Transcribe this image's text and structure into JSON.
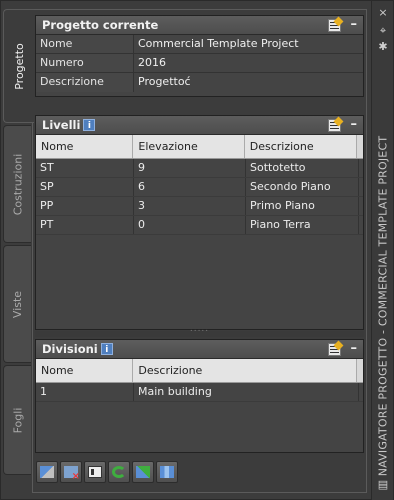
{
  "left_tabs": [
    {
      "label": "Progetto",
      "active": true
    },
    {
      "label": "Costruzioni",
      "active": false
    },
    {
      "label": "Viste",
      "active": false
    },
    {
      "label": "Fogli",
      "active": false
    }
  ],
  "palette_title": "NAVIGATORE PROGETTO - COMMERCIAL TEMPLATE PROJECT",
  "project": {
    "title": "Progetto corrente",
    "rows": [
      {
        "key": "Nome",
        "value": "Commercial Template Project"
      },
      {
        "key": "Numero",
        "value": "2016"
      },
      {
        "key": "Descrizione",
        "value": "Progettoć"
      }
    ]
  },
  "levels": {
    "title": "Livelli",
    "info": "i",
    "columns": [
      "Nome",
      "Elevazione",
      "Descrizione"
    ],
    "rows": [
      [
        "ST",
        "9",
        "Sottotetto"
      ],
      [
        "SP",
        "6",
        "Secondo Piano"
      ],
      [
        "PP",
        "3",
        "Primo Piano"
      ],
      [
        "PT",
        "0",
        "Piano Terra"
      ]
    ]
  },
  "divisions": {
    "title": "Divisioni",
    "info": "i",
    "columns": [
      "Nome",
      "Descrizione"
    ],
    "rows": [
      [
        "1",
        "Main building"
      ]
    ]
  },
  "icons": {
    "close": "×",
    "pin": "⌖",
    "properties": "✱",
    "minimize": "–"
  },
  "toolbar": [
    "project-icon",
    "close-project-icon",
    "project-list-icon",
    "refresh-icon",
    "repath-icon",
    "synchronize-icon"
  ]
}
